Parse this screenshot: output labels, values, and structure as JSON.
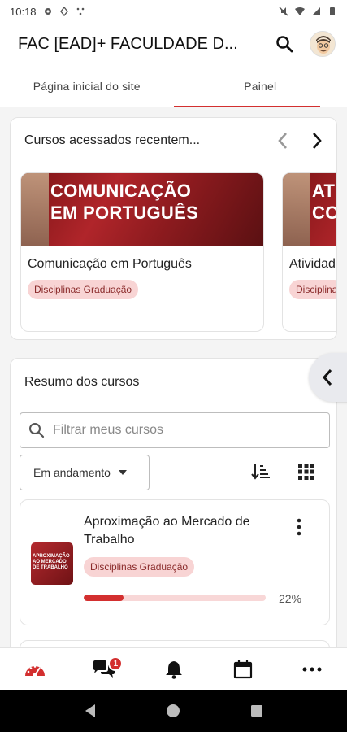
{
  "status_bar": {
    "time": "10:18"
  },
  "header": {
    "title": "FAC [EAD]+ FACULDADE D..."
  },
  "tabs": [
    {
      "label": "Página inicial do site"
    },
    {
      "label": "Painel"
    }
  ],
  "recent": {
    "title": "Cursos acessados recentem...",
    "courses": [
      {
        "banner": "COMUNICAÇÃO EM PORTUGUÊS",
        "name": "Comunicação em Português",
        "category": "Disciplinas Graduação"
      },
      {
        "banner": "AT CO",
        "name": "Atividad",
        "category": "Disciplina"
      }
    ]
  },
  "summary": {
    "title": "Resumo dos cursos",
    "search_placeholder": "Filtrar meus cursos",
    "filter_value": "Em andamento",
    "course": {
      "title": "Aproximação ao Mercado de Trabalho",
      "thumb_text": "APROXIMAÇÃO AO MERCADO DE TRABALHO",
      "category": "Disciplinas Graduação",
      "progress": 0.22,
      "progress_label": "22%"
    }
  },
  "bottom_nav": {
    "messages_badge": "1"
  },
  "colors": {
    "accent": "#d32f2f",
    "badge_bg": "#f8d4d4"
  }
}
